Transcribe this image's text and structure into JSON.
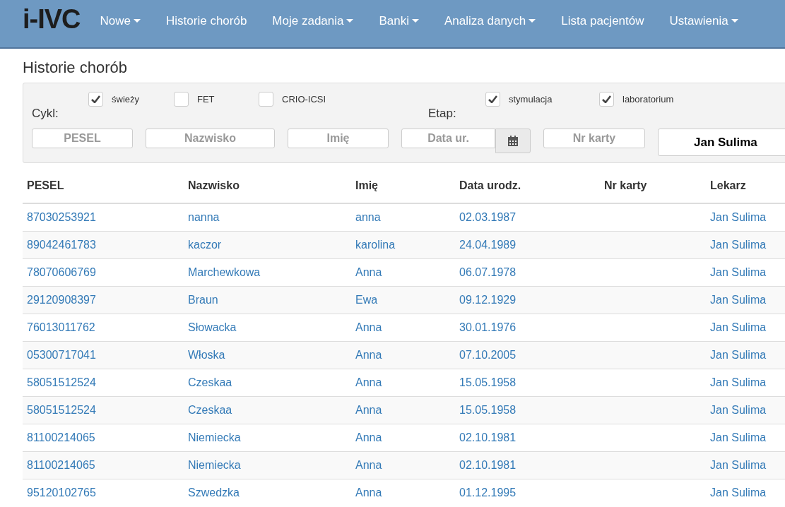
{
  "navbar": {
    "logo": "i-IVC",
    "items": [
      {
        "label": "Nowe",
        "dropdown": true
      },
      {
        "label": "Historie chorób",
        "dropdown": false
      },
      {
        "label": "Moje zadania",
        "dropdown": true
      },
      {
        "label": "Banki",
        "dropdown": true
      },
      {
        "label": "Analiza danych",
        "dropdown": true
      },
      {
        "label": "Lista pacjentów",
        "dropdown": false
      },
      {
        "label": "Ustawienia",
        "dropdown": true
      }
    ]
  },
  "page_title": "Historie chorób",
  "filters": {
    "cycle": {
      "label": "Cykl:",
      "options": [
        {
          "label": "świeży",
          "checked": true
        },
        {
          "label": "FET",
          "checked": false
        },
        {
          "label": "CRIO-ICSI",
          "checked": false
        }
      ]
    },
    "stage": {
      "label": "Etap:",
      "options": [
        {
          "label": "stymulacja",
          "checked": true
        },
        {
          "label": "laboratorium",
          "checked": true
        }
      ]
    },
    "fields": [
      {
        "placeholder": "PESEL",
        "kind": "text"
      },
      {
        "placeholder": "Nazwisko",
        "kind": "text"
      },
      {
        "placeholder": "Imię",
        "kind": "text"
      },
      {
        "placeholder": "Data ur.",
        "kind": "date"
      },
      {
        "placeholder": "Nr karty",
        "kind": "text"
      }
    ],
    "doctor": {
      "value": "Jan Sulima"
    }
  },
  "table": {
    "columns": [
      "PESEL",
      "Nazwisko",
      "Imię",
      "Data urodz.",
      "Nr karty",
      "Lekarz"
    ],
    "rows": [
      {
        "pesel": "87030253921",
        "surname": "nanna",
        "first_name": "anna",
        "birth_date": "02.03.1987",
        "doctor": "Jan Sulima"
      },
      {
        "pesel": "89042461783",
        "surname": "kaczor",
        "first_name": "karolina",
        "birth_date": "24.04.1989",
        "doctor": "Jan Sulima"
      },
      {
        "pesel": "78070606769",
        "surname": "Marchewkowa",
        "first_name": "Anna",
        "birth_date": "06.07.1978",
        "doctor": "Jan Sulima"
      },
      {
        "pesel": "29120908397",
        "surname": "Braun",
        "first_name": "Ewa",
        "birth_date": "09.12.1929",
        "doctor": "Jan Sulima"
      },
      {
        "pesel": "76013011762",
        "surname": "Słowacka",
        "first_name": "Anna",
        "birth_date": "30.01.1976",
        "doctor": "Jan Sulima"
      },
      {
        "pesel": "05300717041",
        "surname": "Włoska",
        "first_name": "Anna",
        "birth_date": "07.10.2005",
        "doctor": "Jan Sulima"
      },
      {
        "pesel": "58051512524",
        "surname": "Czeskaa",
        "first_name": "Anna",
        "birth_date": "15.05.1958",
        "doctor": "Jan Sulima"
      },
      {
        "pesel": "58051512524",
        "surname": "Czeskaa",
        "first_name": "Anna",
        "birth_date": "15.05.1958",
        "doctor": "Jan Sulima"
      },
      {
        "pesel": "81100214065",
        "surname": "Niemiecka",
        "first_name": "Anna",
        "birth_date": "02.10.1981",
        "doctor": "Jan Sulima"
      },
      {
        "pesel": "81100214065",
        "surname": "Niemiecka",
        "first_name": "Anna",
        "birth_date": "02.10.1981",
        "doctor": "Jan Sulima"
      },
      {
        "pesel": "95120102765",
        "surname": "Szwedzka",
        "first_name": "Anna",
        "birth_date": "01.12.1995",
        "doctor": "Jan Sulima"
      }
    ]
  }
}
